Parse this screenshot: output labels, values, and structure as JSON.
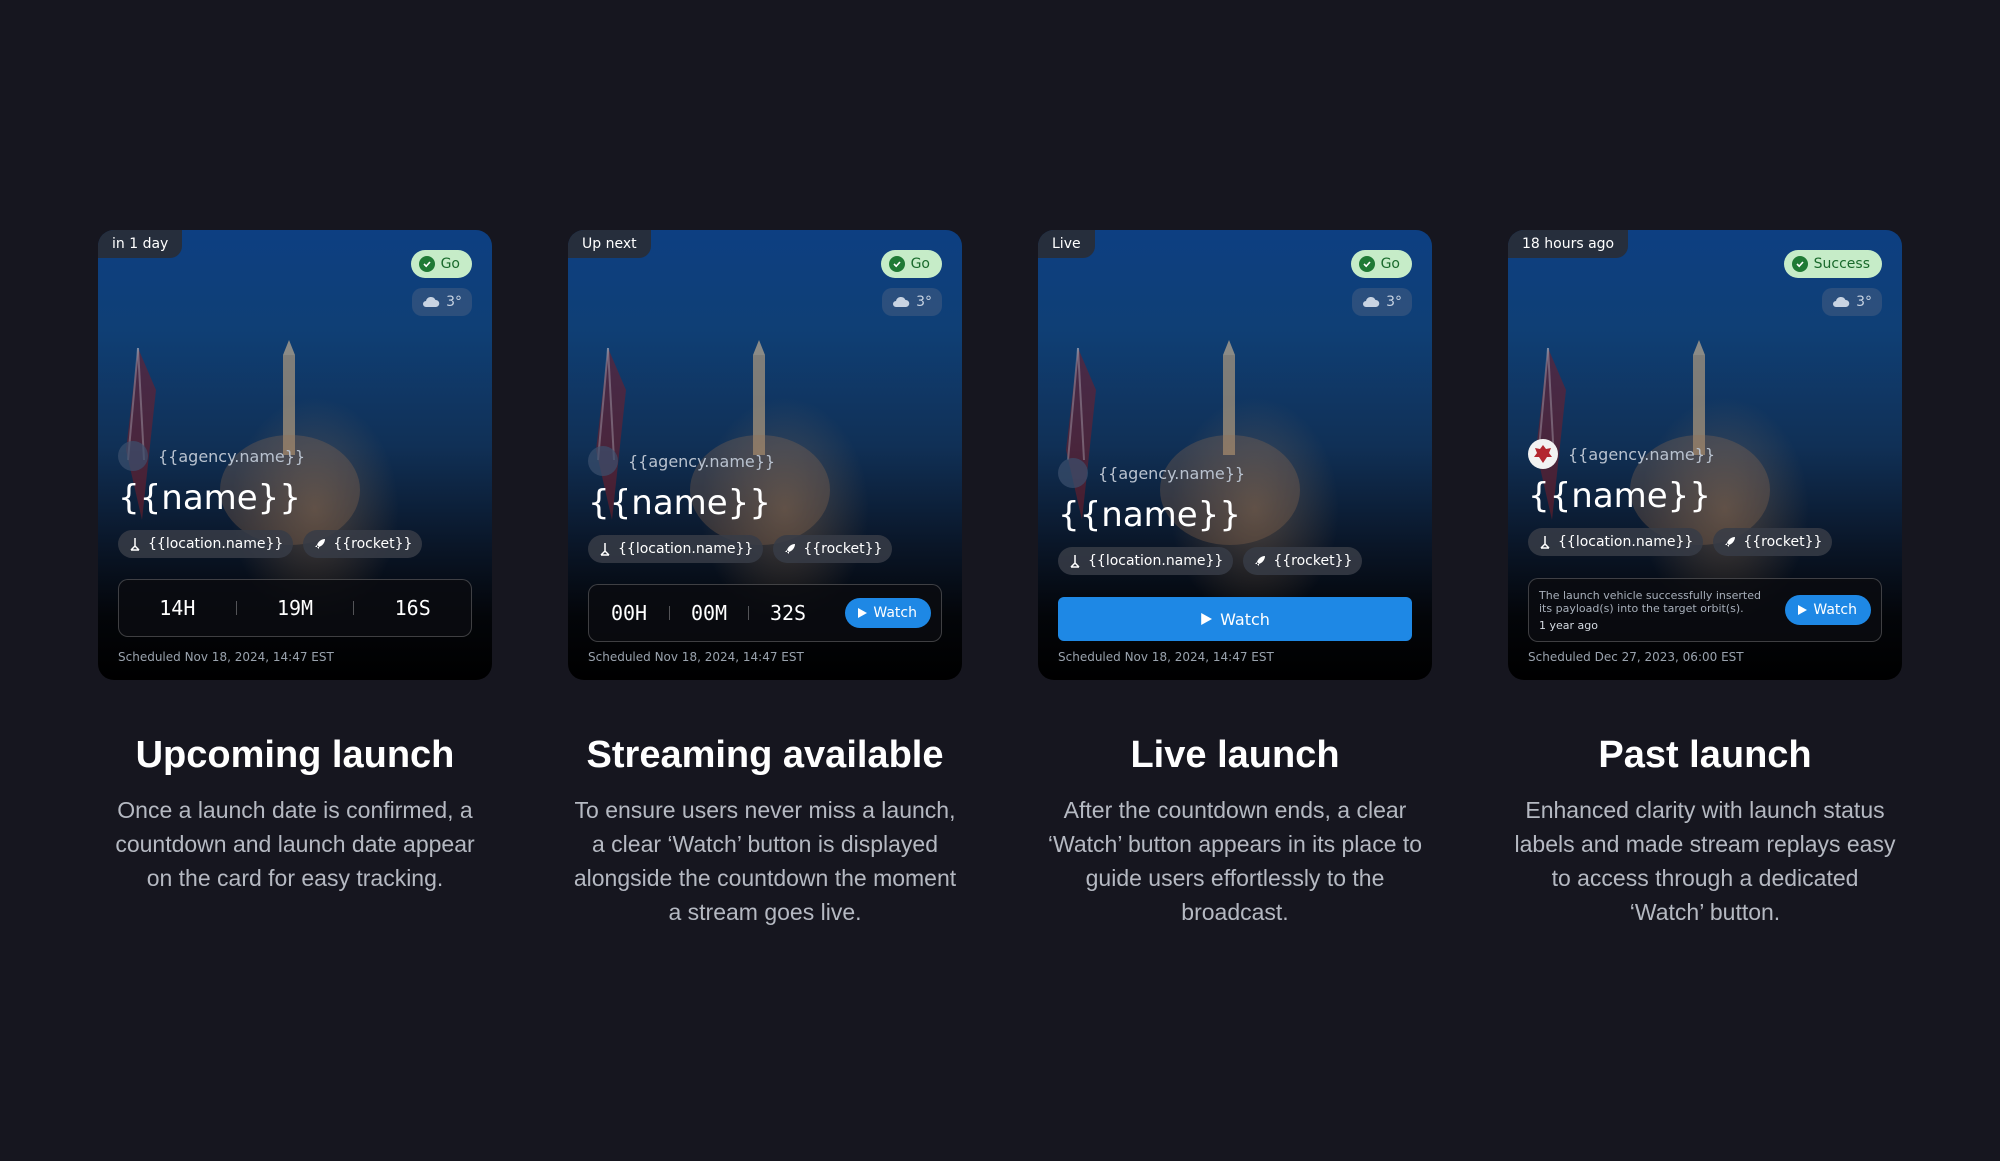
{
  "colors": {
    "background": "#16161f",
    "status_green_bg": "#c6ecc8",
    "status_green_fg": "#1a6a2c",
    "watch_blue": "#1e88e5"
  },
  "icons": {
    "status": "check-circle-icon",
    "weather": "cloud-icon",
    "location": "launchpad-icon",
    "rocket": "rocket-icon",
    "play": "play-icon"
  },
  "cards": [
    {
      "time_label": "in 1 day",
      "status": "Go",
      "temp": "3°",
      "agency": "{{agency.name}}",
      "name": "{{name}}",
      "location": "{{location.name}}",
      "rocket": "{{rocket}}",
      "countdown": [
        "14H",
        "19M",
        "16S"
      ],
      "scheduled": "Scheduled Nov 18, 2024, 14:47 EST",
      "heading": "Upcoming launch",
      "description": "Once a launch date is confirmed, a countdown and launch date appear on the card for easy tracking."
    },
    {
      "time_label": "Up next",
      "status": "Go",
      "temp": "3°",
      "agency": "{{agency.name}}",
      "name": "{{name}}",
      "location": "{{location.name}}",
      "rocket": "{{rocket}}",
      "countdown": [
        "00H",
        "00M",
        "32S"
      ],
      "watch_label": "Watch",
      "scheduled": "Scheduled Nov 18, 2024, 14:47 EST",
      "heading": "Streaming available",
      "description": "To ensure users never miss a launch, a clear ‘Watch’ button is displayed alongside the countdown the moment a stream goes live."
    },
    {
      "time_label": "Live",
      "status": "Go",
      "temp": "3°",
      "agency": "{{agency.name}}",
      "name": "{{name}}",
      "location": "{{location.name}}",
      "rocket": "{{rocket}}",
      "watch_label": "Watch",
      "scheduled": "Scheduled Nov 18, 2024, 14:47 EST",
      "heading": "Live launch",
      "description": "After the countdown ends, a clear ‘Watch’ button appears in its place to guide users effortlessly to the broadcast."
    },
    {
      "time_label": "18 hours ago",
      "status": "Success",
      "temp": "3°",
      "agency": "{{agency.name}}",
      "name": "{{name}}",
      "location": "{{location.name}}",
      "rocket": "{{rocket}}",
      "result_text": "The launch vehicle successfully inserted its payload(s) into the target orbit(s).",
      "result_time": "1 year ago",
      "watch_label": "Watch",
      "scheduled": "Scheduled Dec 27, 2023, 06:00 EST",
      "heading": "Past launch",
      "description": "Enhanced clarity with launch status labels and made stream replays easy to access through a dedicated ‘Watch’ button."
    }
  ]
}
